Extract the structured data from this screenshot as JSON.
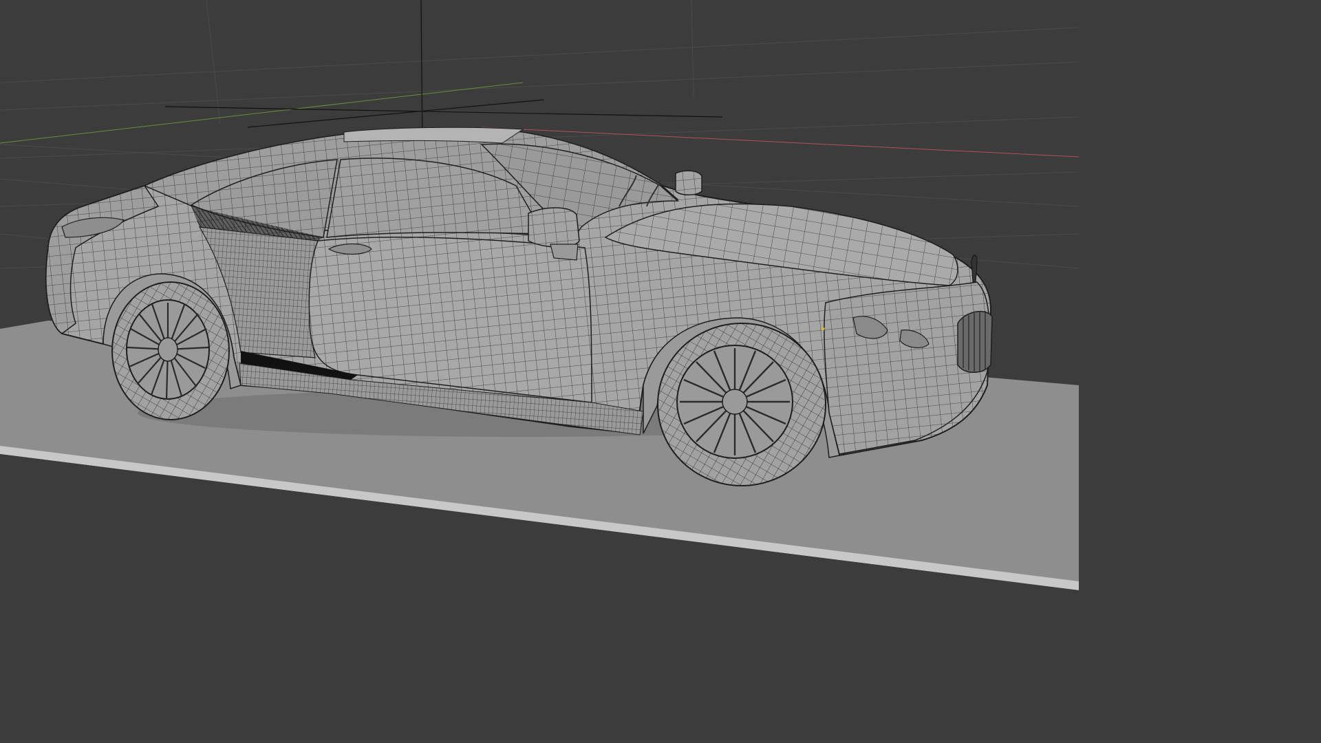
{
  "app": {
    "view": "3d-viewport",
    "shading_mode": "solid-wireframe-overlay",
    "interaction_mode": "object-edit"
  },
  "scene": {
    "subject": "car-mesh",
    "ground": "plane",
    "grid_visible": true,
    "axes_visible": [
      "x",
      "y"
    ],
    "object_origin_visible": true,
    "colors": {
      "background": "#3c3c3c",
      "grid_line": "#4a4a4a",
      "x_axis": "#b05060",
      "y_axis": "#6a8f3a",
      "ground_plane": "#8e8e8e",
      "ground_edge": "#c8c8c8",
      "mesh_body": "#a6a6a6",
      "mesh_wire": "#2a2a2a",
      "shadow": "#1e1e1e",
      "origin": "#d4b03a"
    }
  }
}
